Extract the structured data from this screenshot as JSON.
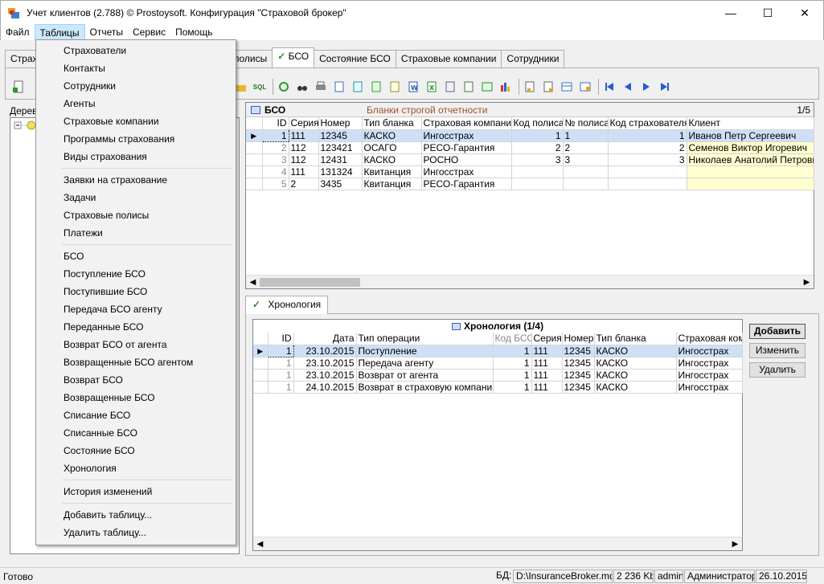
{
  "window": {
    "title": "Учет клиентов (2.788) © Prostoysoft. Конфигурация \"Страховой брокер\"",
    "minimize": "—",
    "maximize": "☐",
    "close": "✕"
  },
  "menu": [
    "Файл",
    "Таблицы",
    "Отчеты",
    "Сервис",
    "Помощь"
  ],
  "tabs": {
    "partial_left": "Страх",
    "partial_policies": "полисы",
    "bso": "БСО",
    "bso_state": "Состояние БСО",
    "insurers": "Страховые компании",
    "employees": "Сотрудники"
  },
  "left_panel": {
    "label": "Дерев"
  },
  "bso_grid": {
    "name": "БСО",
    "description": "Бланки строгой отчетности",
    "page": "1/5",
    "columns": [
      "ID",
      "Серия",
      "Номер",
      "Тип бланка",
      "Страховая компания",
      "Код полиса",
      "№ полиса",
      "Код страхователя",
      "Клиент"
    ],
    "rows": [
      {
        "id": "1",
        "series": "111",
        "number": "12345",
        "type": "КАСКО",
        "company": "Ингосстрах",
        "policy_code": "1",
        "policy_no": "1",
        "client_code": "1",
        "client": "Иванов Петр Сергеевич"
      },
      {
        "id": "2",
        "series": "112",
        "number": "123421",
        "type": "ОСАГО",
        "company": "РЕСО-Гарантия",
        "policy_code": "2",
        "policy_no": "2",
        "client_code": "2",
        "client": "Семенов Виктор Игоревич"
      },
      {
        "id": "3",
        "series": "112",
        "number": "12431",
        "type": "КАСКО",
        "company": "РОСНО",
        "policy_code": "3",
        "policy_no": "3",
        "client_code": "3",
        "client": "Николаев Анатолий Петрович"
      },
      {
        "id": "4",
        "series": "111",
        "number": "131324",
        "type": "Квитанция",
        "company": "Ингосстрах",
        "policy_code": "",
        "policy_no": "",
        "client_code": "",
        "client": ""
      },
      {
        "id": "5",
        "series": "2",
        "number": "3435",
        "type": "Квитанция",
        "company": "РЕСО-Гарантия",
        "policy_code": "",
        "policy_no": "",
        "client_code": "",
        "client": ""
      }
    ]
  },
  "chrono_tab": {
    "label": "Хронология"
  },
  "chrono_grid": {
    "title": "Хронология (1/4)",
    "columns": [
      "ID",
      "Дата",
      "Тип операции",
      "Код БСО",
      "Серия",
      "Номер",
      "Тип бланка",
      "Страховая компа"
    ],
    "rows": [
      {
        "id": "1",
        "date": "23.10.2015",
        "op": "Поступление",
        "bso": "1",
        "series": "111",
        "number": "12345",
        "type": "КАСКО",
        "company": "Ингосстрах"
      },
      {
        "id": "1",
        "date": "23.10.2015",
        "op": "Передача агенту",
        "bso": "1",
        "series": "111",
        "number": "12345",
        "type": "КАСКО",
        "company": "Ингосстрах"
      },
      {
        "id": "1",
        "date": "23.10.2015",
        "op": "Возврат от агента",
        "bso": "1",
        "series": "111",
        "number": "12345",
        "type": "КАСКО",
        "company": "Ингосстрах"
      },
      {
        "id": "1",
        "date": "24.10.2015",
        "op": "Возврат в страховую компанию",
        "bso": "1",
        "series": "111",
        "number": "12345",
        "type": "КАСКО",
        "company": "Ингосстрах"
      }
    ]
  },
  "chrono_buttons": {
    "add": "Добавить",
    "edit": "Изменить",
    "delete": "Удалить"
  },
  "dropdown": {
    "groups": [
      [
        "Страхователи",
        "Контакты",
        "Сотрудники",
        "Агенты",
        "Страховые компании",
        "Программы страхования",
        "Виды страхования"
      ],
      [
        "Заявки на страхование",
        "Задачи",
        "Страховые полисы",
        "Платежи"
      ],
      [
        "БСО",
        "Поступление БСО",
        "Поступившие БСО",
        "Передача БСО агенту",
        "Переданные БСО",
        "Возврат БСО от агента",
        "Возвращенные БСО агентом",
        "Возврат БСО",
        "Возвращенные БСО",
        "Списание БСО",
        "Списанные БСО",
        "Состояние БСО",
        "Хронология"
      ],
      [
        "История изменений"
      ],
      [
        "Добавить таблицу...",
        "Удалить таблицу..."
      ]
    ]
  },
  "status": {
    "ready": "Готово",
    "db_label": "БД:",
    "db_path": "D:\\InsuranceBroker.mdb",
    "size": "2 236 Kb",
    "user": "admin",
    "role": "Администратор",
    "date": "26.10.2015"
  }
}
